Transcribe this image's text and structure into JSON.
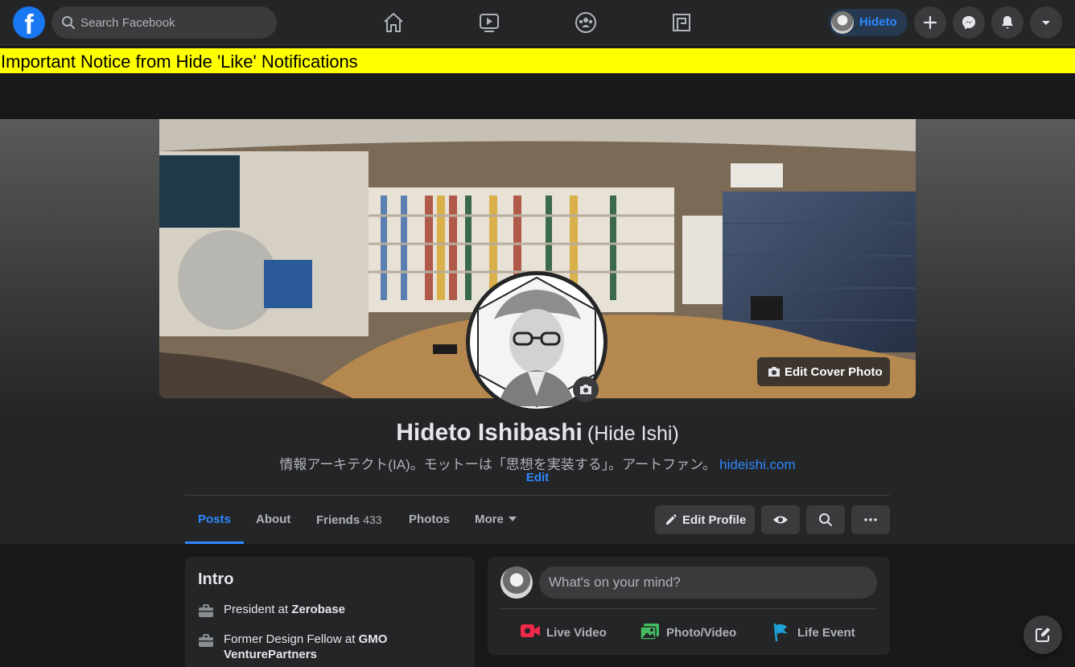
{
  "topbar": {
    "logo": "f",
    "search_placeholder": "Search Facebook",
    "nav_icons": [
      "home-icon",
      "watch-icon",
      "groups-icon",
      "gaming-icon"
    ],
    "profile_name": "Hideto",
    "actions": [
      "create-icon",
      "messenger-icon",
      "notifications-icon",
      "account-menu-icon"
    ]
  },
  "notice": "Important Notice from Hide 'Like' Notifications",
  "cover": {
    "edit_cover_label": "Edit Cover Photo"
  },
  "profile": {
    "name": "Hideto Ishibashi",
    "alt_name": "(Hide Ishi)",
    "bio": "情報アーキテクト(IA)。モットーは「思想を実装する」。アートファン。",
    "bio_link": "hideishi.com",
    "bio_edit": "Edit"
  },
  "tabs": {
    "posts": "Posts",
    "about": "About",
    "friends": "Friends",
    "friends_count": "433",
    "photos": "Photos",
    "more": "More"
  },
  "actions": {
    "edit_profile": "Edit Profile"
  },
  "intro": {
    "title": "Intro",
    "items": [
      {
        "prefix": "President at ",
        "bold": "Zerobase"
      },
      {
        "prefix": "Former Design Fellow at ",
        "bold": "GMO VenturePartners"
      }
    ]
  },
  "composer": {
    "placeholder": "What's on your mind?",
    "live_video": "Live Video",
    "photo_video": "Photo/Video",
    "life_event": "Life Event"
  },
  "colors": {
    "accent": "#2d88ff",
    "notice_bg": "#ffff00",
    "surface": "#242526",
    "background": "#18191a"
  }
}
